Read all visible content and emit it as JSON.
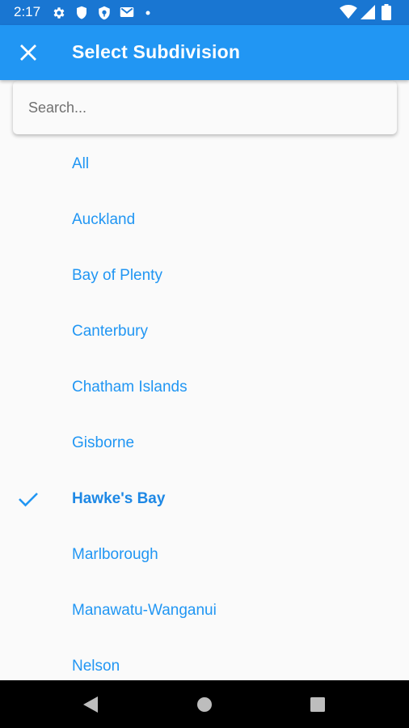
{
  "status_bar": {
    "time": "2:17",
    "icons_left": [
      "settings-icon",
      "shield-icon",
      "vpn-shield-icon",
      "gmail-icon",
      "dot-icon"
    ],
    "icons_right": [
      "wifi-icon",
      "signal-icon",
      "battery-icon"
    ]
  },
  "app_bar": {
    "title": "Select Subdivision",
    "close_icon": "close-icon",
    "color": "#2196f3"
  },
  "search": {
    "placeholder": "Search...",
    "value": ""
  },
  "list": {
    "accent_color": "#2196f3",
    "selected": "Hawke's Bay",
    "items": [
      {
        "label": "All"
      },
      {
        "label": "Auckland"
      },
      {
        "label": "Bay of Plenty"
      },
      {
        "label": "Canterbury"
      },
      {
        "label": "Chatham Islands"
      },
      {
        "label": "Gisborne"
      },
      {
        "label": "Hawke's Bay"
      },
      {
        "label": "Marlborough"
      },
      {
        "label": "Manawatu-Wanganui"
      },
      {
        "label": "Nelson"
      }
    ]
  },
  "nav_bar": {
    "buttons": [
      "back-icon",
      "home-icon",
      "recents-icon"
    ]
  }
}
